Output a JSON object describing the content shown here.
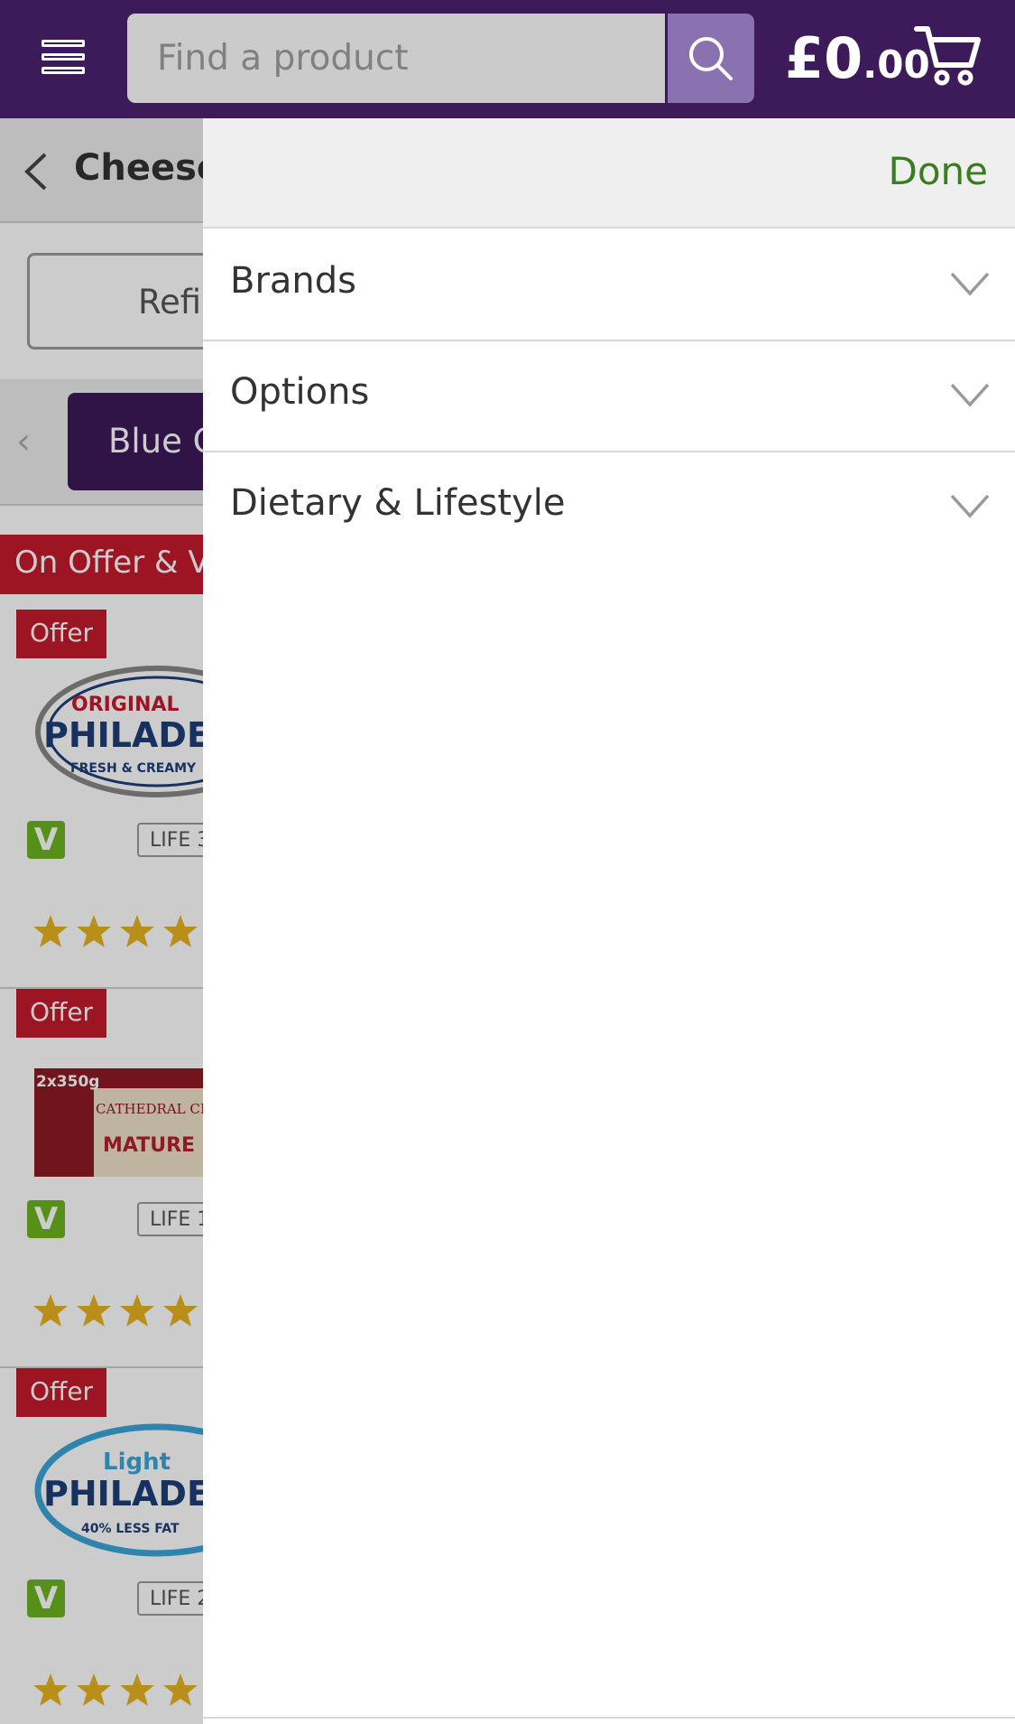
{
  "header": {
    "search_placeholder": "Find a product",
    "basket_pounds": "£0",
    "basket_pence": ".00",
    "brand_color": "#3d1a59"
  },
  "underlay": {
    "page_title": "Cheese",
    "refine_label": "Refine",
    "chip_label": "Blue Cheese",
    "offer_banner": "On Offer & Value",
    "products": [
      {
        "tag": "Offer",
        "veg": "V",
        "life": "LIFE 3",
        "image_text_top": "ORIGINAL",
        "image_text_mid": "PHILADELPHIA",
        "image_text_bot": "FRESH & CREAMY",
        "stars": 4
      },
      {
        "tag": "Offer",
        "veg": "V",
        "life": "LIFE 1",
        "image_text_top": "2x350g",
        "image_text_mid": "CATHEDRAL CITY",
        "image_text_bot": "MATURE",
        "stars": 4
      },
      {
        "tag": "Offer",
        "veg": "V",
        "life": "LIFE 2",
        "image_text_top": "Light",
        "image_text_mid": "PHILADELPHIA",
        "image_text_bot": "40% LESS FAT",
        "stars": 4
      }
    ]
  },
  "panel": {
    "done_label": "Done",
    "filters": [
      "Brands",
      "Options",
      "Dietary & Lifestyle"
    ]
  }
}
